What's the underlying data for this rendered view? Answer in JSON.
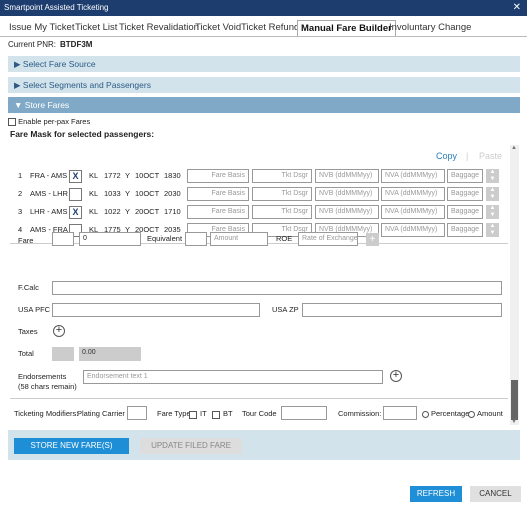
{
  "window": {
    "title": "Smartpoint Assisted Ticketing",
    "close": "✕"
  },
  "tabs": [
    {
      "label": "Issue My Ticket"
    },
    {
      "label": "Ticket List"
    },
    {
      "label": "Ticket Revalidation"
    },
    {
      "label": "Ticket Void"
    },
    {
      "label": "Ticket Refund"
    },
    {
      "label": "Manual Fare Builder"
    },
    {
      "label": "Involuntary Change"
    }
  ],
  "pnr": {
    "label": "Current PNR:",
    "value": "BTDF3M"
  },
  "sections": {
    "fare_source": "▶ Select Fare Source",
    "segments": "▶ Select Segments and Passengers",
    "store_fares": "▼ Store Fares"
  },
  "enable_per_pax": "Enable per-pax Fares",
  "fare_mask_title": "Fare Mask for selected passengers:",
  "copy": "Copy",
  "paste": "Paste",
  "segments": [
    {
      "num": "1",
      "route": "FRA - AMS",
      "x": "X",
      "carrier": "KL",
      "flight": "1772",
      "cls": "Y",
      "date": "10OCT",
      "time": "1830"
    },
    {
      "num": "2",
      "route": "AMS - LHR",
      "x": "",
      "carrier": "KL",
      "flight": "1033",
      "cls": "Y",
      "date": "10OCT",
      "time": "2030"
    },
    {
      "num": "3",
      "route": "LHR - AMS",
      "x": "X",
      "carrier": "KL",
      "flight": "1022",
      "cls": "Y",
      "date": "20OCT",
      "time": "1710"
    },
    {
      "num": "4",
      "route": "AMS - FRA",
      "x": "",
      "carrier": "KL",
      "flight": "1775",
      "cls": "Y",
      "date": "20OCT",
      "time": "2035"
    }
  ],
  "seg_placeholders": {
    "fare_basis": "Fare Basis",
    "tkt_dsgr": "Tkt Dsgr",
    "nvb": "NVB (ddMMMyy)",
    "nva": "NVA (ddMMMyy)",
    "baggage": "Baggage"
  },
  "fare": {
    "label": "Fare",
    "value": "0",
    "equivalent_label": "Equivalent",
    "amount_placeholder": "Amount",
    "roe_label": "ROE",
    "roe_placeholder": "Rate of Exchange"
  },
  "fcalc_label": "F.Calc",
  "usa_pfc_label": "USA PFC",
  "usa_zp_label": "USA ZP",
  "taxes_label": "Taxes",
  "total": {
    "label": "Total",
    "value": "0.00"
  },
  "endorsements": {
    "label": "Endorsements",
    "sublabel": "(58 chars remain)",
    "placeholder": "Endorsement text 1"
  },
  "modifiers": {
    "label": "Ticketing Modifiers:",
    "plating_label": "Plating Carrier",
    "fare_type_label": "Fare Type",
    "it": "IT",
    "bt": "BT",
    "tour_code_label": "Tour Code",
    "commission_label": "Commission:",
    "percentage": "Percentage",
    "amount": "Amount"
  },
  "buttons": {
    "store_new": "STORE NEW FARE(S)",
    "update_filed": "UPDATE FILED FARE",
    "refresh": "REFRESH",
    "cancel": "CANCEL"
  }
}
